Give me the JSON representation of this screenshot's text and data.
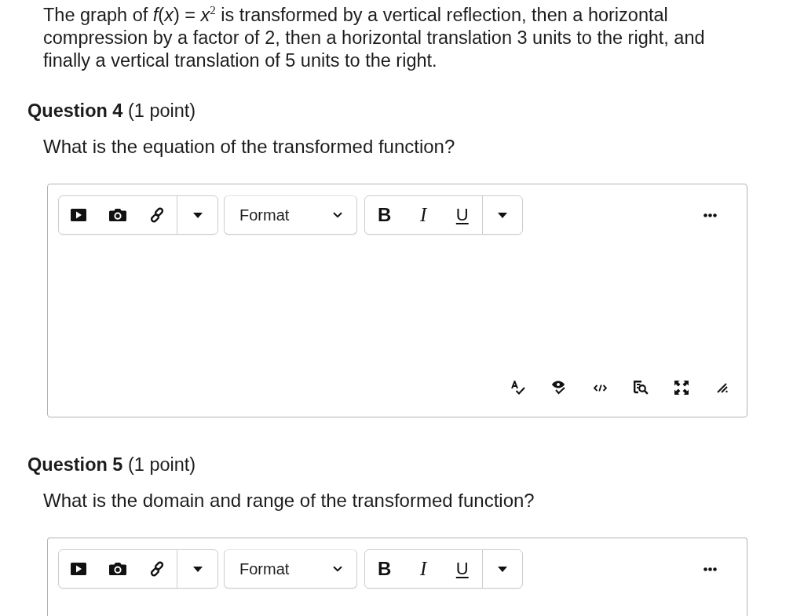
{
  "intro": {
    "text": "The graph of *f*(*x*) = *x*$^{2}$ is transformed by a vertical reflection, then a horizontal compression by a factor of 2, then a horizontal translation 3 units to the right, and finally a vertical translation of 5 units to the right."
  },
  "questions": [
    {
      "heading": "**Question 4** (1 point)",
      "prompt": "What is the equation of the transformed function?",
      "editor": {
        "format_label": "Format",
        "bold_label": "B",
        "italic_label": "I",
        "underline_label": "U",
        "footer_tools_shown": true
      }
    },
    {
      "heading": "**Question 5** (1 point)",
      "prompt": "What is the domain and range of the transformed function?",
      "editor": {
        "format_label": "Format",
        "bold_label": "B",
        "italic_label": "I",
        "underline_label": "U",
        "footer_tools_shown": false
      }
    }
  ]
}
